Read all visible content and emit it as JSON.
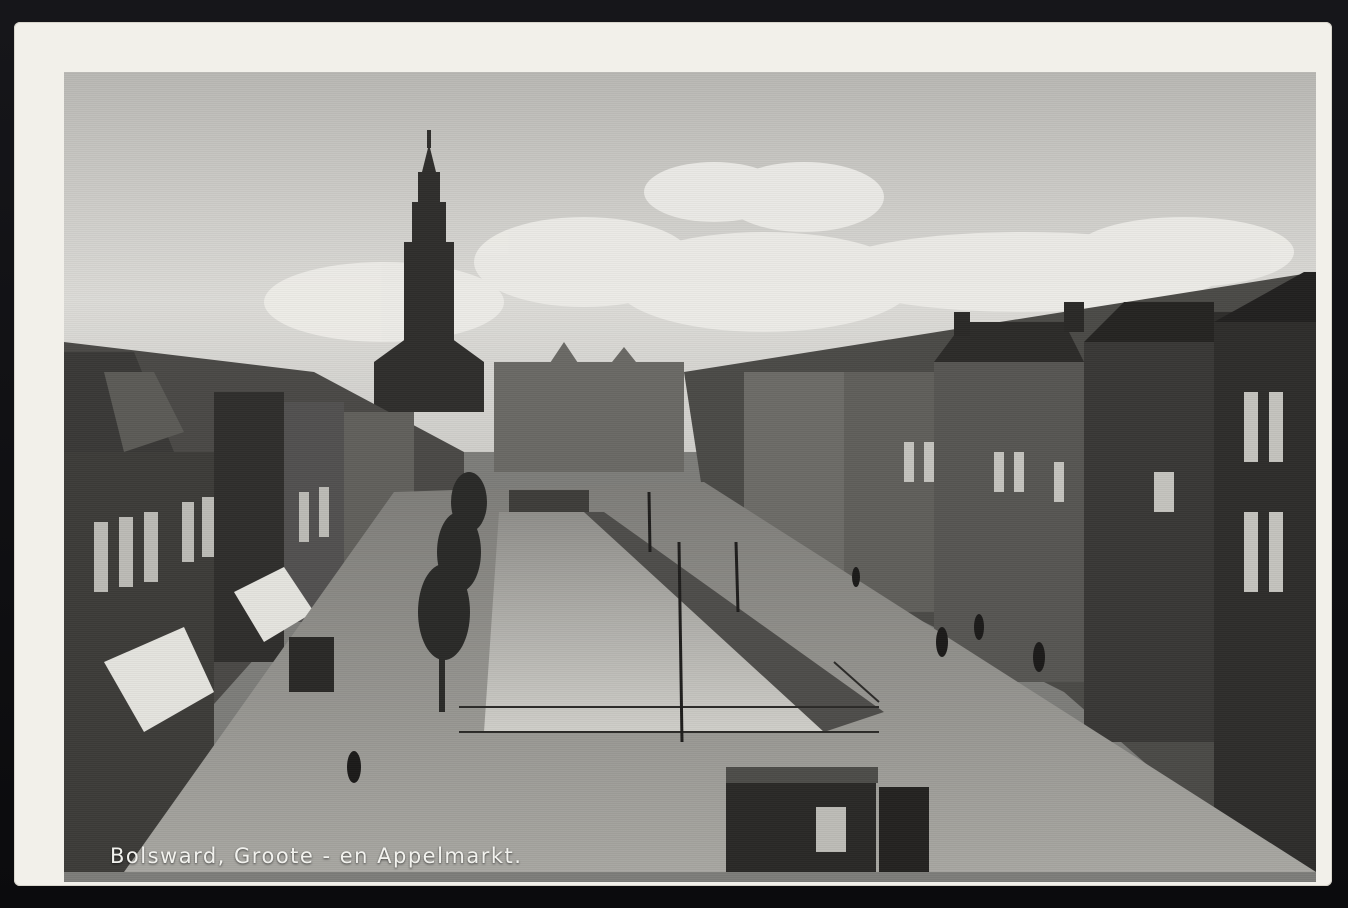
{
  "postcard": {
    "caption": "Bolsward, Groote - en Appelmarkt."
  },
  "colors": {
    "border": "#f2f0ea",
    "sky": "#d9d8d4",
    "building_dark": "#3a3937",
    "pavement": "#9a9995",
    "water": "#c2c1bc"
  }
}
